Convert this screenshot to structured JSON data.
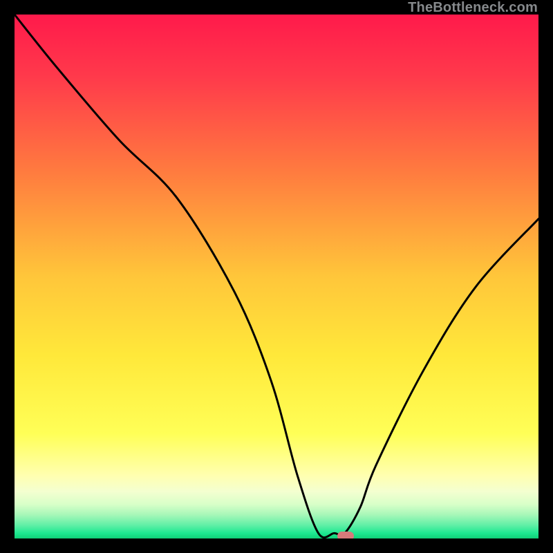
{
  "watermark": "TheBottleneck.com",
  "chart_data": {
    "type": "line",
    "title": "",
    "xlabel": "",
    "ylabel": "",
    "xlim": [
      0,
      100
    ],
    "ylim": [
      0,
      100
    ],
    "grid": false,
    "legend": false,
    "annotations": [],
    "series": [
      {
        "name": "bottleneck-curve",
        "x": [
          0,
          8,
          20,
          31,
          42,
          49,
          54,
          58,
          61,
          63,
          66,
          69,
          78,
          88,
          100
        ],
        "values": [
          100,
          90,
          76,
          65,
          47,
          30,
          12,
          1,
          1,
          1,
          6,
          14,
          32,
          48,
          61
        ]
      }
    ],
    "marker": {
      "x_pct": 63.2,
      "y_pct": 0.5,
      "color": "#d77a7b"
    },
    "background_gradient": {
      "stops": [
        {
          "pos": 0.0,
          "color": "#ff1a4b"
        },
        {
          "pos": 0.12,
          "color": "#ff3a4b"
        },
        {
          "pos": 0.3,
          "color": "#ff7b3f"
        },
        {
          "pos": 0.5,
          "color": "#ffc63a"
        },
        {
          "pos": 0.65,
          "color": "#ffe83a"
        },
        {
          "pos": 0.8,
          "color": "#ffff57"
        },
        {
          "pos": 0.88,
          "color": "#ffffb0"
        },
        {
          "pos": 0.91,
          "color": "#f4ffd0"
        },
        {
          "pos": 0.935,
          "color": "#d8ffc8"
        },
        {
          "pos": 0.955,
          "color": "#a6f7b8"
        },
        {
          "pos": 0.975,
          "color": "#5fefa6"
        },
        {
          "pos": 0.99,
          "color": "#1de890"
        },
        {
          "pos": 1.0,
          "color": "#0fcf77"
        }
      ]
    }
  }
}
